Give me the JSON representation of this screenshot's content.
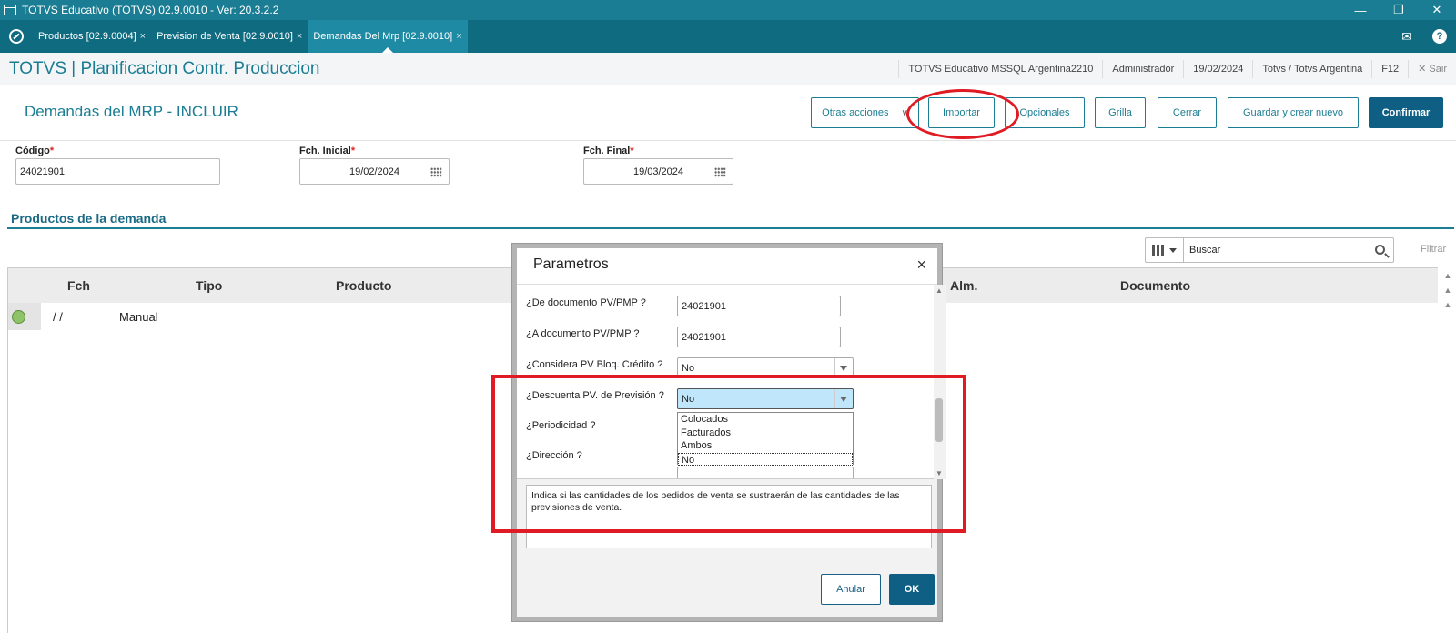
{
  "window": {
    "title": "TOTVS Educativo (TOTVS) 02.9.0010 - Ver: 20.3.2.2",
    "controls": [
      "—",
      "❐",
      "✕"
    ]
  },
  "tabs": [
    {
      "label": "Productos [02.9.0004]",
      "close": "×"
    },
    {
      "label": "Prevision de Venta [02.9.0010]",
      "close": "×"
    },
    {
      "label": "Demandas Del Mrp [02.9.0010]",
      "close": "×"
    }
  ],
  "tabbar_right": {
    "mail_icon": "✉",
    "help": "?"
  },
  "header": {
    "brand": "TOTVS | Planificacion Contr. Produccion",
    "environment": "TOTVS Educativo MSSQL Argentina2210",
    "user": "Administrador",
    "date": "19/02/2024",
    "company": "Totvs / Totvs Argentina",
    "shortcut": "F12",
    "exit": "✕  Sair"
  },
  "page": {
    "title": "Demandas del MRP - INCLUIR"
  },
  "toolbar": {
    "otras_acciones": "Otras acciones",
    "otras_chev": "∨",
    "importar": "Importar",
    "opcionales": "Opcionales",
    "grilla": "Grilla",
    "cerrar": "Cerrar",
    "guardar_nuevo": "Guardar y crear nuevo",
    "confirmar": "Confirmar"
  },
  "form": {
    "codigo_label": "Código",
    "codigo_value": "24021901",
    "fch_inicial_label": "Fch. Inicial",
    "fch_inicial_value": "19/02/2024",
    "fch_final_label": "Fch. Final",
    "fch_final_value": "19/03/2024",
    "required_mark": "*"
  },
  "section": {
    "title": "Productos de la demanda"
  },
  "search": {
    "placeholder": "Buscar",
    "filter": "Filtrar"
  },
  "grid": {
    "headers": {
      "fch": "Fch",
      "tipo": "Tipo",
      "producto": "Producto",
      "alm": "c. Alm.",
      "documento": "Documento"
    },
    "row": {
      "fch": " /  /",
      "tipo": "Manual"
    }
  },
  "dialog": {
    "title": "Parametros",
    "close": "×",
    "params": [
      {
        "label": "¿De documento PV/PMP ?",
        "value": "24021901"
      },
      {
        "label": "¿A documento PV/PMP ?",
        "value": "24021901"
      },
      {
        "label": "¿Considera PV Bloq. Crédito ?",
        "value": "No"
      },
      {
        "label": "¿Descuenta PV. de Previsión ?",
        "value": "No"
      },
      {
        "label": "¿Periodicidad ?",
        "value": ""
      },
      {
        "label": "¿Dirección ?",
        "value": ""
      }
    ],
    "dropdown_options": [
      "Colocados",
      "Facturados",
      "Ambos",
      "No"
    ],
    "help_text": "Indica si las cantidades de los pedidos de venta se sustraerán de las cantidades de las previsiones de venta.",
    "anular": "Anular",
    "ok": "OK"
  },
  "annotations": {
    "color": "#e01b24"
  },
  "colors": {
    "brand": "#1a7d93",
    "primary_button": "#0f5f85",
    "status_green": "#8ec36a"
  }
}
